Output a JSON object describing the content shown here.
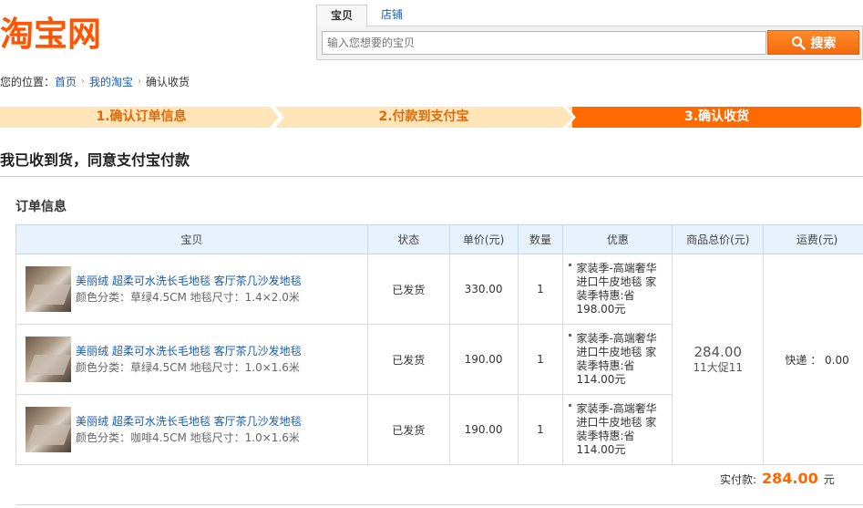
{
  "header": {
    "logo_text": "淘宝网",
    "search": {
      "tabs": [
        "宝贝",
        "店铺"
      ],
      "active_tab": "宝贝",
      "placeholder": "输入您想要的宝贝",
      "button_label": "搜索"
    }
  },
  "breadcrumb": {
    "prefix": "您的位置：",
    "items": [
      "首页",
      "我的淘宝",
      "确认收货"
    ]
  },
  "steps": [
    "1.确认订单信息",
    "2.付款到支付宝",
    "3.确认收货"
  ],
  "current_step": 3,
  "page_heading": "我已收到货，同意支付宝付款",
  "order_section_title": "订单信息",
  "table": {
    "headers": [
      "宝贝",
      "状态",
      "单价(元)",
      "数量",
      "优惠",
      "商品总价(元)",
      "运费(元)"
    ],
    "rows": [
      {
        "title": "美丽绒 超柔可水洗长毛地毯 客厅茶几沙发地毯",
        "sku": "颜色分类：草绿4.5CM   地毯尺寸：1.4×2.0米",
        "status": "已发货",
        "price": "330.00",
        "quantity": "1",
        "promo_line1": "家装季-高端奢华进口牛皮地毯 家装季特惠:省",
        "promo_line2": "198.00元"
      },
      {
        "title": "美丽绒 超柔可水洗长毛地毯 客厅茶几沙发地毯",
        "sku": "颜色分类：草绿4.5CM   地毯尺寸：1.0×1.6米",
        "status": "已发货",
        "price": "190.00",
        "quantity": "1",
        "promo_line1": "家装季-高端奢华进口牛皮地毯 家装季特惠:省",
        "promo_line2": "114.00元"
      },
      {
        "title": "美丽绒 超柔可水洗长毛地毯 客厅茶几沙发地毯",
        "sku": "颜色分类：咖啡4.5CM   地毯尺寸：1.0×1.6米",
        "status": "已发货",
        "price": "190.00",
        "quantity": "1",
        "promo_line1": "家装季-高端奢华进口牛皮地毯 家装季特惠:省",
        "promo_line2": "114.00元"
      }
    ],
    "goods_total": "284.00",
    "goods_total_note": "11大促11",
    "shipping": "快递 ： 0.00"
  },
  "paid": {
    "label": "实付款:",
    "amount": "284.00",
    "unit": "元"
  },
  "colors": {
    "brand": "#ff5500",
    "step_active": "#ff6a00",
    "step_inactive": "#ffe5b8",
    "link": "#1a5ca8",
    "table_header_bg": "#e8f2fd"
  }
}
